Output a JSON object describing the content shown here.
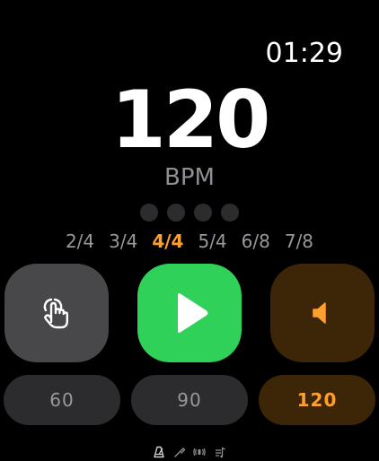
{
  "status": {
    "time": "01:29"
  },
  "metronome": {
    "tempo": "120",
    "unit": "BPM",
    "beats_per_bar": 4,
    "time_signatures": [
      "2/4",
      "3/4",
      "4/4",
      "5/4",
      "6/8",
      "7/8"
    ],
    "selected_time_signature": "4/4"
  },
  "controls": {
    "tap_icon": "tap-hand-icon",
    "play_icon": "play-icon",
    "sound_icon": "speaker-icon"
  },
  "presets": [
    "60",
    "90",
    "120"
  ],
  "selected_preset": "120",
  "colors": {
    "accent": "#ff9f2e",
    "play": "#30d158",
    "background": "#000000"
  },
  "bottom_icons": [
    "metronome-icon",
    "tuning-fork-icon",
    "haptic-icon",
    "audio-output-icon"
  ]
}
